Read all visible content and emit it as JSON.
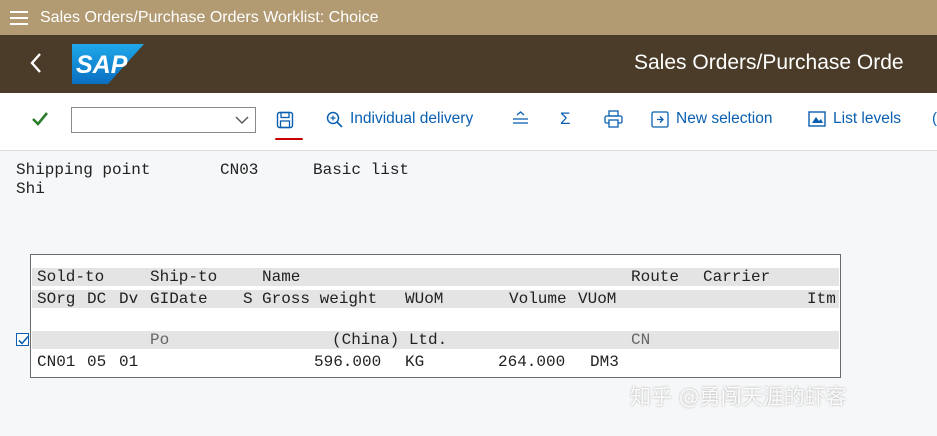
{
  "window": {
    "title": "Sales Orders/Purchase Orders Worklist: Choice"
  },
  "shell": {
    "logo": "SAP",
    "title": "Sales Orders/Purchase Orde"
  },
  "toolbar": {
    "combo_value": "",
    "individual_delivery": "Individual delivery",
    "sum_symbol": "Σ",
    "new_selection": "New selection",
    "list_levels": "List levels"
  },
  "header": {
    "shipping_point_label": "Shipping point",
    "shipping_point_value": "CN03",
    "list_type": "Basic list",
    "row2_fragment": "Shi"
  },
  "list": {
    "col_header_1": [
      "Sold-to",
      "Ship-to",
      "Name",
      "Route",
      "Carrier"
    ],
    "col_header_2": [
      "SOrg",
      "DC",
      "Dv",
      "GIDate",
      "S",
      "Gross weight",
      "WUoM",
      "Volume",
      "VUoM",
      "Itm"
    ],
    "row1": {
      "ship_to": "Po",
      "name": "(China) Ltd.",
      "route": "CN"
    },
    "row2": {
      "sorg": "CN01",
      "dc": "05",
      "dv": "01",
      "gross_weight": "596.000",
      "wuom": "KG",
      "volume": "264.000",
      "vuom": "DM3"
    }
  },
  "watermark": "知乎 @勇闯天涯的虾客",
  "colors": {
    "title_bar": "#b29a72",
    "shell_bar": "#4a3c28",
    "accent_link": "#0a5fb0",
    "confirm_green": "#2b7d2b",
    "highlight_underline": "#cc0000"
  }
}
